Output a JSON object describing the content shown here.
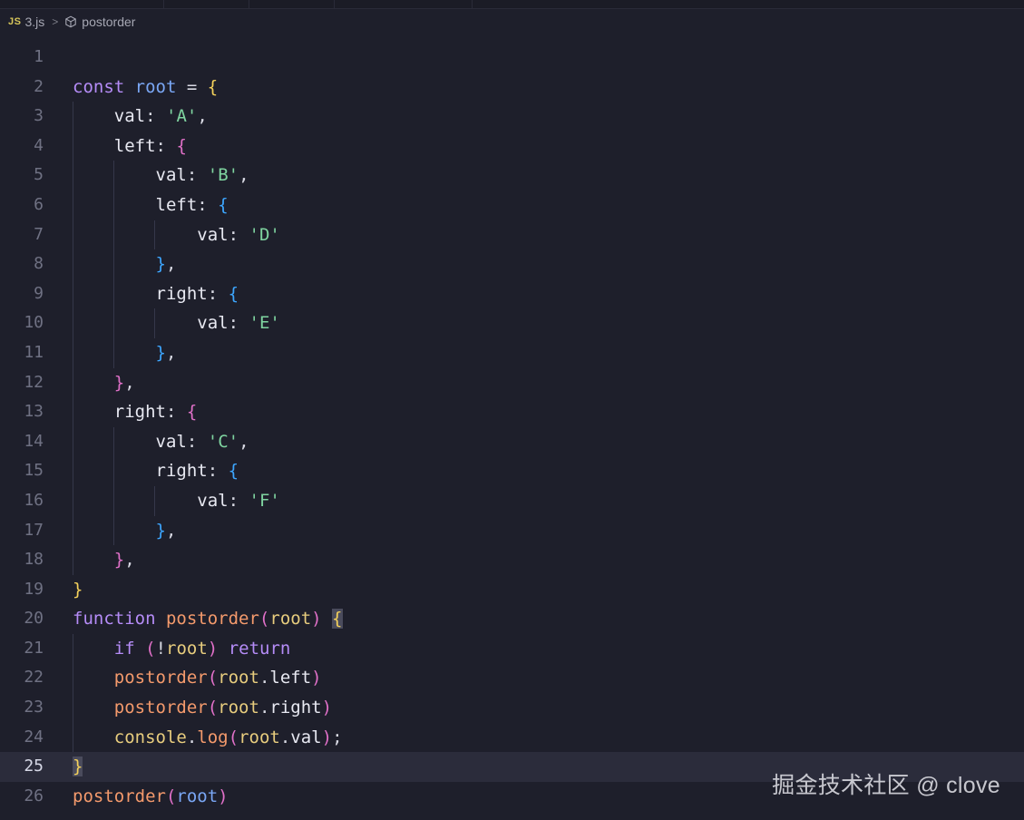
{
  "breadcrumb": {
    "lang_badge": "JS",
    "file": "3.js",
    "separator": ">",
    "symbol_icon": "cube-icon",
    "symbol": "postorder"
  },
  "editor": {
    "current_line": 25,
    "lines": [
      {
        "n": "1",
        "tokens": []
      },
      {
        "n": "2",
        "tokens": [
          [
            "kw",
            "const"
          ],
          [
            "sp",
            " "
          ],
          [
            "var",
            "root"
          ],
          [
            "sp",
            " "
          ],
          [
            "punc",
            "="
          ],
          [
            "sp",
            " "
          ],
          [
            "b1",
            "{"
          ]
        ]
      },
      {
        "n": "3",
        "tokens": [
          [
            "sp",
            "    "
          ],
          [
            "prop",
            "val"
          ],
          [
            "punc",
            ":"
          ],
          [
            "sp",
            " "
          ],
          [
            "str",
            "'A'"
          ],
          [
            "punc",
            ","
          ]
        ]
      },
      {
        "n": "4",
        "tokens": [
          [
            "sp",
            "    "
          ],
          [
            "prop",
            "left"
          ],
          [
            "punc",
            ":"
          ],
          [
            "sp",
            " "
          ],
          [
            "b2",
            "{"
          ]
        ]
      },
      {
        "n": "5",
        "tokens": [
          [
            "sp",
            "        "
          ],
          [
            "prop",
            "val"
          ],
          [
            "punc",
            ":"
          ],
          [
            "sp",
            " "
          ],
          [
            "str",
            "'B'"
          ],
          [
            "punc",
            ","
          ]
        ]
      },
      {
        "n": "6",
        "tokens": [
          [
            "sp",
            "        "
          ],
          [
            "prop",
            "left"
          ],
          [
            "punc",
            ":"
          ],
          [
            "sp",
            " "
          ],
          [
            "b3",
            "{"
          ]
        ]
      },
      {
        "n": "7",
        "tokens": [
          [
            "sp",
            "            "
          ],
          [
            "prop",
            "val"
          ],
          [
            "punc",
            ":"
          ],
          [
            "sp",
            " "
          ],
          [
            "str",
            "'D'"
          ]
        ]
      },
      {
        "n": "8",
        "tokens": [
          [
            "sp",
            "        "
          ],
          [
            "b3",
            "}"
          ],
          [
            "punc",
            ","
          ]
        ]
      },
      {
        "n": "9",
        "tokens": [
          [
            "sp",
            "        "
          ],
          [
            "prop",
            "right"
          ],
          [
            "punc",
            ":"
          ],
          [
            "sp",
            " "
          ],
          [
            "b3",
            "{"
          ]
        ]
      },
      {
        "n": "10",
        "tokens": [
          [
            "sp",
            "            "
          ],
          [
            "prop",
            "val"
          ],
          [
            "punc",
            ":"
          ],
          [
            "sp",
            " "
          ],
          [
            "str",
            "'E'"
          ]
        ]
      },
      {
        "n": "11",
        "tokens": [
          [
            "sp",
            "        "
          ],
          [
            "b3",
            "}"
          ],
          [
            "punc",
            ","
          ]
        ]
      },
      {
        "n": "12",
        "tokens": [
          [
            "sp",
            "    "
          ],
          [
            "b2",
            "}"
          ],
          [
            "punc",
            ","
          ]
        ]
      },
      {
        "n": "13",
        "tokens": [
          [
            "sp",
            "    "
          ],
          [
            "prop",
            "right"
          ],
          [
            "punc",
            ":"
          ],
          [
            "sp",
            " "
          ],
          [
            "b2",
            "{"
          ]
        ]
      },
      {
        "n": "14",
        "tokens": [
          [
            "sp",
            "        "
          ],
          [
            "prop",
            "val"
          ],
          [
            "punc",
            ":"
          ],
          [
            "sp",
            " "
          ],
          [
            "str",
            "'C'"
          ],
          [
            "punc",
            ","
          ]
        ]
      },
      {
        "n": "15",
        "tokens": [
          [
            "sp",
            "        "
          ],
          [
            "prop",
            "right"
          ],
          [
            "punc",
            ":"
          ],
          [
            "sp",
            " "
          ],
          [
            "b3",
            "{"
          ]
        ]
      },
      {
        "n": "16",
        "tokens": [
          [
            "sp",
            "            "
          ],
          [
            "prop",
            "val"
          ],
          [
            "punc",
            ":"
          ],
          [
            "sp",
            " "
          ],
          [
            "str",
            "'F'"
          ]
        ]
      },
      {
        "n": "17",
        "tokens": [
          [
            "sp",
            "        "
          ],
          [
            "b3",
            "}"
          ],
          [
            "punc",
            ","
          ]
        ]
      },
      {
        "n": "18",
        "tokens": [
          [
            "sp",
            "    "
          ],
          [
            "b2",
            "}"
          ],
          [
            "punc",
            ","
          ]
        ]
      },
      {
        "n": "19",
        "tokens": [
          [
            "b1",
            "}"
          ]
        ]
      },
      {
        "n": "20",
        "tokens": [
          [
            "kw",
            "function"
          ],
          [
            "sp",
            " "
          ],
          [
            "fn",
            "postorder"
          ],
          [
            "b2",
            "("
          ],
          [
            "param",
            "root"
          ],
          [
            "b2",
            ")"
          ],
          [
            "sp",
            " "
          ],
          [
            "b1 hl",
            "{"
          ]
        ]
      },
      {
        "n": "21",
        "tokens": [
          [
            "sp",
            "    "
          ],
          [
            "kw",
            "if"
          ],
          [
            "sp",
            " "
          ],
          [
            "b2",
            "("
          ],
          [
            "punc",
            "!"
          ],
          [
            "param",
            "root"
          ],
          [
            "b2",
            ")"
          ],
          [
            "sp",
            " "
          ],
          [
            "kw",
            "return"
          ]
        ]
      },
      {
        "n": "22",
        "tokens": [
          [
            "sp",
            "    "
          ],
          [
            "fn",
            "postorder"
          ],
          [
            "b2",
            "("
          ],
          [
            "param",
            "root"
          ],
          [
            "punc",
            "."
          ],
          [
            "prop",
            "left"
          ],
          [
            "b2",
            ")"
          ]
        ]
      },
      {
        "n": "23",
        "tokens": [
          [
            "sp",
            "    "
          ],
          [
            "fn",
            "postorder"
          ],
          [
            "b2",
            "("
          ],
          [
            "param",
            "root"
          ],
          [
            "punc",
            "."
          ],
          [
            "prop",
            "right"
          ],
          [
            "b2",
            ")"
          ]
        ]
      },
      {
        "n": "24",
        "tokens": [
          [
            "sp",
            "    "
          ],
          [
            "obj",
            "console"
          ],
          [
            "punc",
            "."
          ],
          [
            "meth",
            "log"
          ],
          [
            "b2",
            "("
          ],
          [
            "param",
            "root"
          ],
          [
            "punc",
            "."
          ],
          [
            "prop",
            "val"
          ],
          [
            "b2",
            ")"
          ],
          [
            "punc",
            ";"
          ]
        ]
      },
      {
        "n": "25",
        "tokens": [
          [
            "b1 hl",
            "}"
          ]
        ]
      },
      {
        "n": "26",
        "tokens": [
          [
            "fn",
            "postorder"
          ],
          [
            "b2",
            "("
          ],
          [
            "var",
            "root"
          ],
          [
            "b2",
            ")"
          ]
        ]
      }
    ]
  },
  "watermark": "掘金技术社区 @ clove",
  "colors": {
    "background": "#1e1f2b",
    "keyword": "#b58cf7",
    "string": "#7fd4a0",
    "function": "#f49a6c",
    "bracket_level1": "#f3d05b",
    "bracket_level2": "#e070c8",
    "bracket_level3": "#3da6ff"
  }
}
